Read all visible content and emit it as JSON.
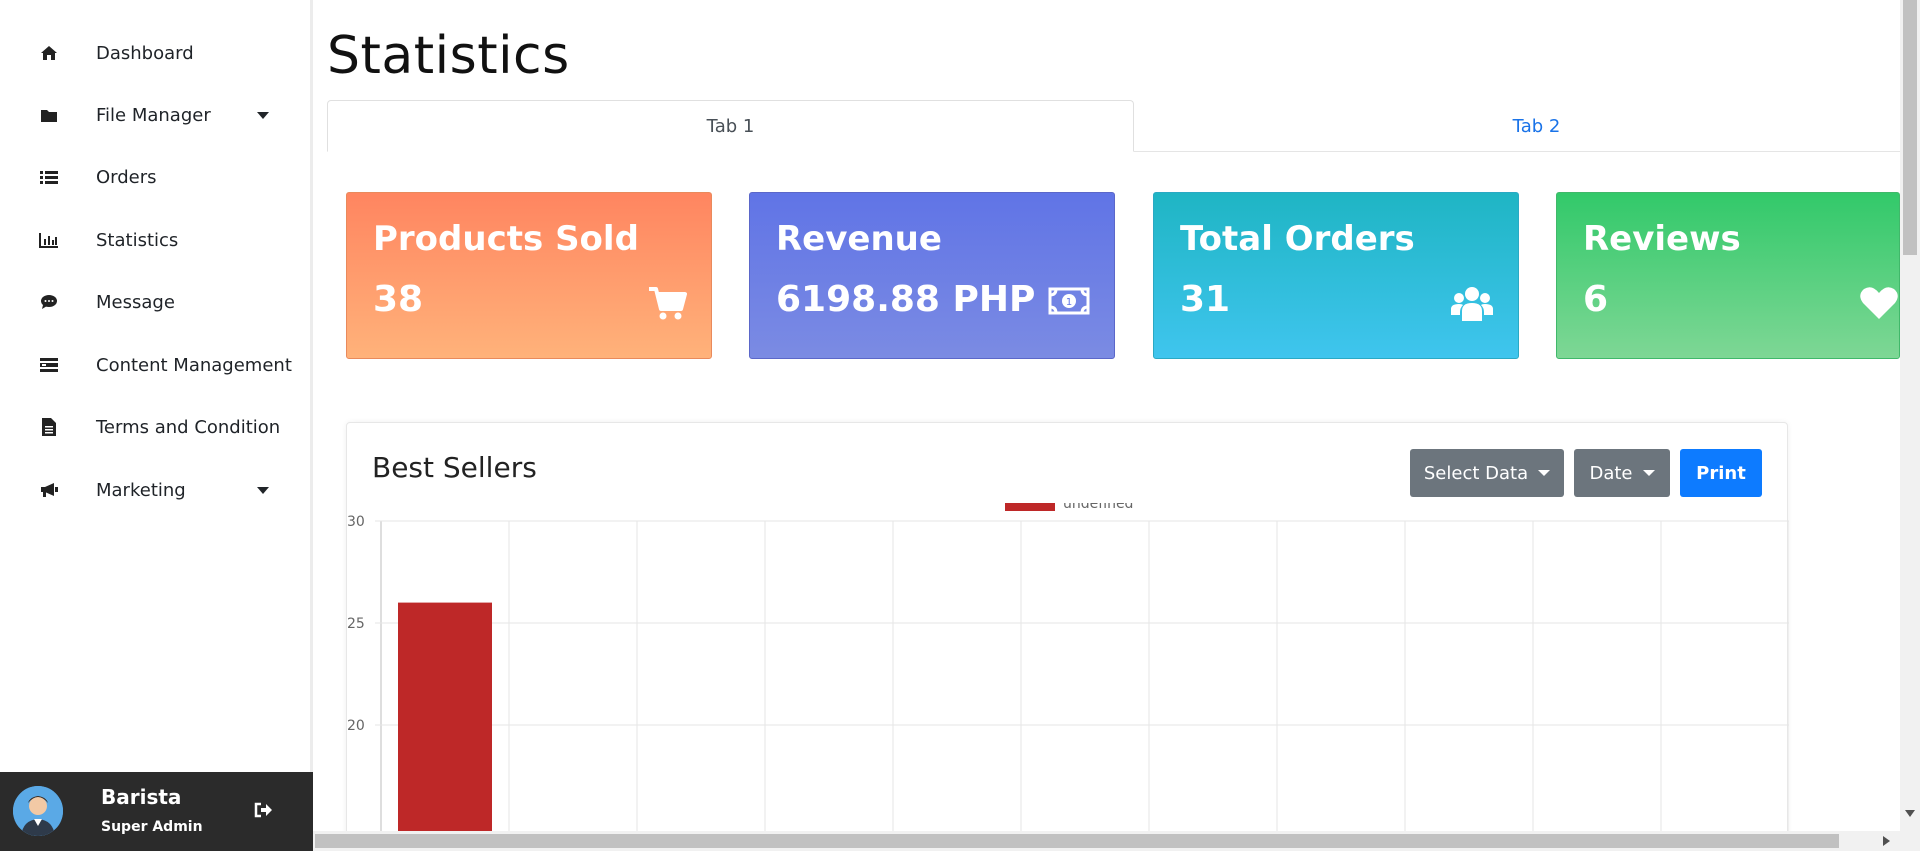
{
  "sidebar": {
    "items": [
      {
        "label": "Dashboard",
        "icon": "home-icon",
        "has_caret": false
      },
      {
        "label": "File Manager",
        "icon": "folder-icon",
        "has_caret": true
      },
      {
        "label": "Orders",
        "icon": "list-icon",
        "has_caret": false
      },
      {
        "label": "Statistics",
        "icon": "bar-chart-icon",
        "has_caret": false
      },
      {
        "label": "Message",
        "icon": "comment-icon",
        "has_caret": false
      },
      {
        "label": "Content Management",
        "icon": "content-icon",
        "has_caret": false
      },
      {
        "label": "Terms and Condition",
        "icon": "document-icon",
        "has_caret": false
      },
      {
        "label": "Marketing",
        "icon": "megaphone-icon",
        "has_caret": true
      }
    ]
  },
  "profile": {
    "name": "Barista",
    "role": "Super Admin"
  },
  "page": {
    "title": "Statistics"
  },
  "tabs": [
    {
      "label": "Tab 1",
      "active": true
    },
    {
      "label": "Tab 2",
      "active": false
    }
  ],
  "cards": [
    {
      "title": "Products Sold",
      "value": "38",
      "icon": "cart-icon",
      "color": "#ff8560"
    },
    {
      "title": "Revenue",
      "value": "6198.88 PHP",
      "icon": "money-icon",
      "color": "#6074e6"
    },
    {
      "title": "Total Orders",
      "value": "31",
      "icon": "users-icon",
      "color": "#1fb5c4"
    },
    {
      "title": "Reviews",
      "value": "6",
      "icon": "heart-icon",
      "color": "#32c96a"
    }
  ],
  "best_sellers": {
    "title": "Best Sellers",
    "select_data_label": "Select Data",
    "date_label": "Date",
    "print_label": "Print"
  },
  "chart_data": {
    "type": "bar",
    "legend": [
      "undefined"
    ],
    "series": [
      {
        "name": "undefined",
        "values": [
          26
        ],
        "color": "#be2828"
      }
    ],
    "y_ticks": [
      30,
      25,
      20
    ],
    "ylim_visible": [
      19.6,
      30
    ],
    "column_count": 11,
    "grid": true,
    "legend_position": "top-center"
  }
}
